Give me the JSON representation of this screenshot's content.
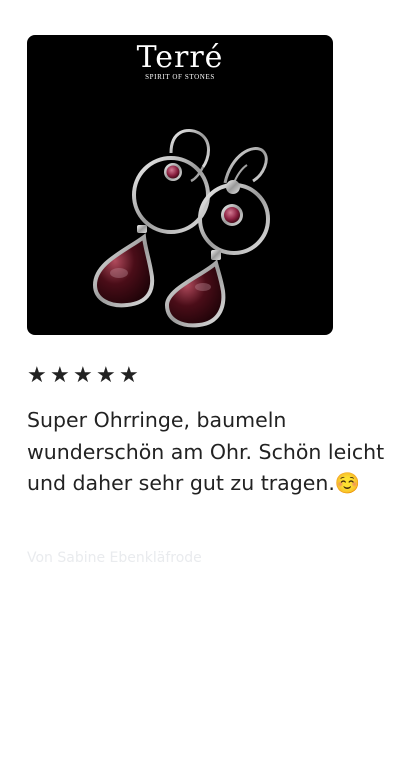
{
  "review": {
    "image": {
      "logo_wordmark": "Terré",
      "logo_tagline": "SPIRIT OF STONES",
      "background_color": "#000000"
    },
    "rating": {
      "value": 5,
      "max": 5,
      "stars": [
        "★",
        "★",
        "★",
        "★",
        "★"
      ]
    },
    "text": "Super Ohrringe, baumeln wunderschön am Ohr. Schön leicht und daher sehr gut zu tragen.☺️",
    "faded_meta": "Von Sabine Ebenkläfrode"
  },
  "colors": {
    "text": "#222222",
    "meta_faded": "#e9ebee",
    "photo_bg": "#000000"
  }
}
